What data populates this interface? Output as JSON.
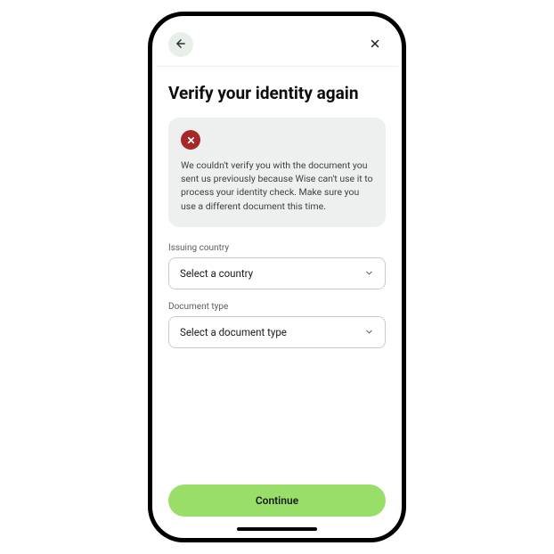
{
  "header": {
    "back_icon": "arrow-left",
    "close_icon": "x"
  },
  "title": "Verify your identity again",
  "alert": {
    "icon": "error-x",
    "message": "We couldn't verify you with the document you sent us previously because Wise can't use it to process your identity check. Make sure you use a different document this time."
  },
  "fields": {
    "country": {
      "label": "Issuing country",
      "placeholder": "Select a country"
    },
    "doc_type": {
      "label": "Document type",
      "placeholder": "Select a document type"
    }
  },
  "footer": {
    "continue_label": "Continue"
  }
}
